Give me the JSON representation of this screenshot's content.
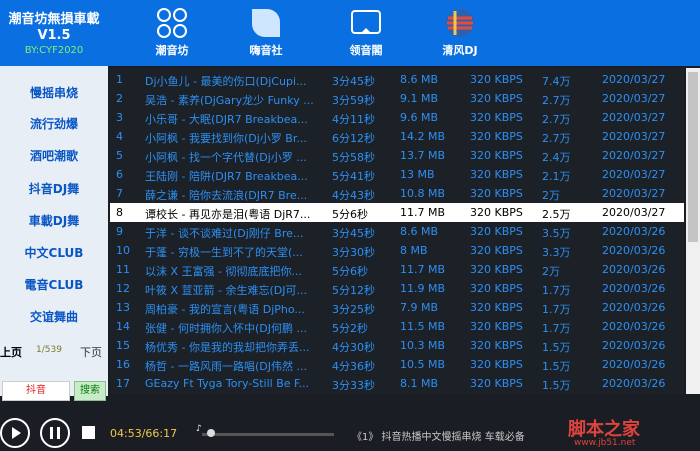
{
  "brand": {
    "line1": "潮音坊無損車載",
    "version": "V1.5",
    "author": "BY:CYF2020"
  },
  "nav_tabs": [
    {
      "label": "潮音坊",
      "icon": "grid-flower-icon"
    },
    {
      "label": "嗨音社",
      "icon": "leaf-icon"
    },
    {
      "label": "领音閣",
      "icon": "screen-cast-icon"
    },
    {
      "label": "清风DJ",
      "icon": "globe-flag-icon"
    }
  ],
  "sidebar": {
    "items": [
      "慢摇串烧",
      "流行劲爆",
      "酒吧潮歌",
      "抖音DJ舞",
      "車載DJ舞",
      "中文CLUB",
      "電音CLUB",
      "交谊舞曲"
    ],
    "prev": "上页",
    "page_count": "1/539",
    "next": "下页",
    "search_value": "抖音",
    "search_button": "搜索"
  },
  "songs": [
    {
      "num": "1",
      "title": "Dj小鱼儿 - 最美的伤口(DjCupi...",
      "duration": "3分45秒",
      "size": "8.6 MB",
      "bitrate": "320 KBPS",
      "plays": "7.4万",
      "date": "2020/03/27"
    },
    {
      "num": "2",
      "title": "吴浩 - 素养(DjGary龙少 Funky ...",
      "duration": "3分59秒",
      "size": "9.1 MB",
      "bitrate": "320 KBPS",
      "plays": "2.7万",
      "date": "2020/03/27"
    },
    {
      "num": "3",
      "title": "小乐哥 - 大眠(DJR7 Breakbea...",
      "duration": "4分11秒",
      "size": "9.6 MB",
      "bitrate": "320 KBPS",
      "plays": "2.7万",
      "date": "2020/03/27"
    },
    {
      "num": "4",
      "title": "小阿枫 - 我要找到你(Dj小罗 Br...",
      "duration": "6分12秒",
      "size": "14.2 MB",
      "bitrate": "320 KBPS",
      "plays": "2.7万",
      "date": "2020/03/27"
    },
    {
      "num": "5",
      "title": "小阿枫 - 找一个字代替(Dj小罗 ...",
      "duration": "5分58秒",
      "size": "13.7 MB",
      "bitrate": "320 KBPS",
      "plays": "2.4万",
      "date": "2020/03/27"
    },
    {
      "num": "6",
      "title": "王陆刚 - 陪阱(DJR7 Breakbea...",
      "duration": "5分41秒",
      "size": "13 MB",
      "bitrate": "320 KBPS",
      "plays": "2.1万",
      "date": "2020/03/27"
    },
    {
      "num": "7",
      "title": "薛之谦 - 陪你去流浪(DJR7 Bre...",
      "duration": "4分43秒",
      "size": "10.8 MB",
      "bitrate": "320 KBPS",
      "plays": "2万",
      "date": "2020/03/27"
    },
    {
      "num": "8",
      "title": "谭校长 - 再见亦是泪(粤语 DjR7...",
      "duration": "5分6秒",
      "size": "11.7 MB",
      "bitrate": "320 KBPS",
      "plays": "2.5万",
      "date": "2020/03/27"
    },
    {
      "num": "9",
      "title": "于洋 - 谈不谈难过(Dj刚仔 Bre...",
      "duration": "3分45秒",
      "size": "8.6 MB",
      "bitrate": "320 KBPS",
      "plays": "3.5万",
      "date": "2020/03/26"
    },
    {
      "num": "10",
      "title": "于蓬 - 穷极一生到不了的天堂(...",
      "duration": "3分30秒",
      "size": "8 MB",
      "bitrate": "320 KBPS",
      "plays": "3.3万",
      "date": "2020/03/26"
    },
    {
      "num": "11",
      "title": "以沫 X 王富强 - 彻彻底底把你...",
      "duration": "5分6秒",
      "size": "11.7 MB",
      "bitrate": "320 KBPS",
      "plays": "2万",
      "date": "2020/03/26"
    },
    {
      "num": "12",
      "title": "叶筱 X 荁亚箭 - 余生难忘(DJ可...",
      "duration": "5分12秒",
      "size": "11.9 MB",
      "bitrate": "320 KBPS",
      "plays": "1.7万",
      "date": "2020/03/26"
    },
    {
      "num": "13",
      "title": "周柏豪 - 我的宣言(粤语 DjPho...",
      "duration": "3分25秒",
      "size": "7.9 MB",
      "bitrate": "320 KBPS",
      "plays": "1.7万",
      "date": "2020/03/26"
    },
    {
      "num": "14",
      "title": "张健 - 何时拥你入怀中(DJ何鹏 ...",
      "duration": "5分2秒",
      "size": "11.5 MB",
      "bitrate": "320 KBPS",
      "plays": "1.7万",
      "date": "2020/03/26"
    },
    {
      "num": "15",
      "title": "杨优秀 - 你是我的我却把你弄丢...",
      "duration": "4分30秒",
      "size": "10.3 MB",
      "bitrate": "320 KBPS",
      "plays": "1.5万",
      "date": "2020/03/26"
    },
    {
      "num": "16",
      "title": "杨哲 - 一路风雨一路唱(DJ伟然 ...",
      "duration": "4分36秒",
      "size": "10.5 MB",
      "bitrate": "320 KBPS",
      "plays": "1.5万",
      "date": "2020/03/26"
    },
    {
      "num": "17",
      "title": "GEazy Ft Tyga Tory-Still Be F...",
      "duration": "3分33秒",
      "size": "8.1 MB",
      "bitrate": "320 KBPS",
      "plays": "1.5万",
      "date": "2020/03/26"
    }
  ],
  "selected_index": 7,
  "player": {
    "time": "04:53/66:17",
    "progress": 0.07,
    "ticker": "《1》   抖音热播中文慢摇串烧  车载必备"
  },
  "watermark": {
    "main": "脚本之家",
    "url": "www.jb51.net"
  },
  "colors": {
    "header": "#0a6fe0",
    "list_text": "#2d8ff2",
    "sidebar_text": "#0a57c4",
    "accent_red": "#e0433b"
  }
}
